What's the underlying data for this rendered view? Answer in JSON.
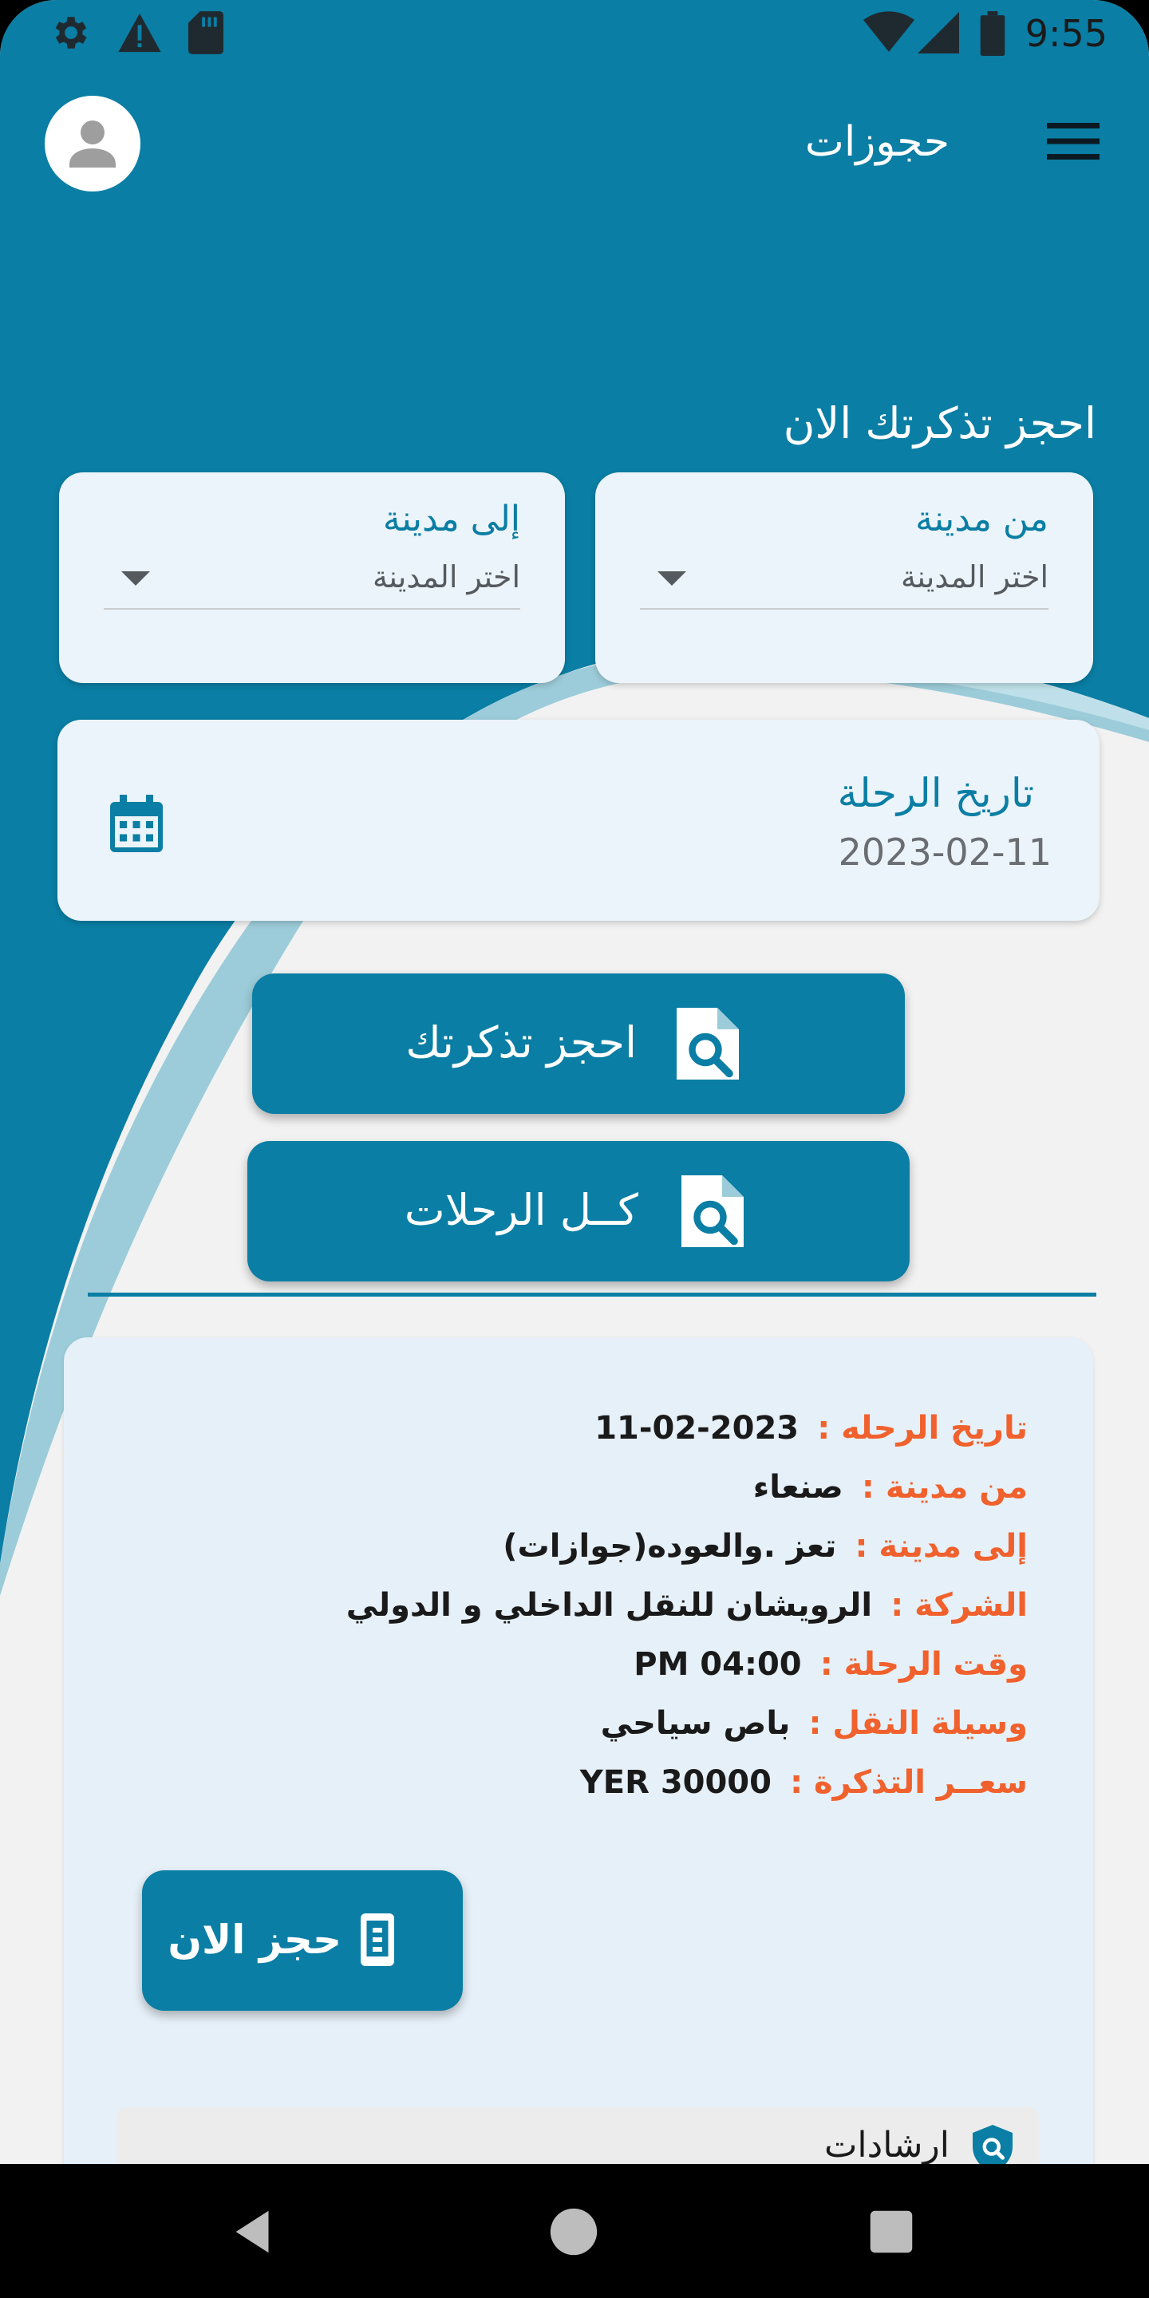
{
  "status_bar": {
    "time": "9:55",
    "icons": [
      "settings-icon",
      "warning-icon",
      "sd-card-icon",
      "wifi-icon",
      "signal-icon",
      "battery-icon"
    ]
  },
  "app_bar": {
    "title": "حجوزات",
    "menu_icon": "hamburger-menu-icon",
    "avatar_icon": "person-icon"
  },
  "search": {
    "heading": "احجز تذكرتك الان",
    "from_city": {
      "label": "من مدينة",
      "value": "اختر المدينة"
    },
    "to_city": {
      "label": "إلى مدينة",
      "value": "اختر المدينة"
    },
    "trip_date": {
      "label": "تاريخ الرحلة",
      "value": "2023-02-11",
      "icon": "calendar-icon"
    },
    "book_ticket_button": "احجز تذكرتك",
    "all_trips_button": "كــل الرحلات"
  },
  "trip": {
    "rows": [
      {
        "key": "تاريخ الرحله :",
        "value": "2023-02-11"
      },
      {
        "key": "من مدينة :",
        "value": "صنعاء"
      },
      {
        "key": "إلى مدينة :",
        "value": "تعز .والعوده(جوازات)"
      },
      {
        "key": "الشركة :",
        "value": "الرويشان للنقل الداخلي و الدولي"
      },
      {
        "key": "وقت الرحلة :",
        "value": "PM 04:00"
      },
      {
        "key": "وسيلة النقل :",
        "value": "باص سياحي"
      },
      {
        "key": "سعــر التذكرة :",
        "value": "YER 30000"
      }
    ],
    "book_now_button": "حجز الان",
    "notice_label": "ارشادات"
  },
  "colors": {
    "primary": "#0a7ea4",
    "accent_label": "#f0612d",
    "card_bg": "#ebf4fa",
    "screen_bg": "#f2f2f2"
  }
}
